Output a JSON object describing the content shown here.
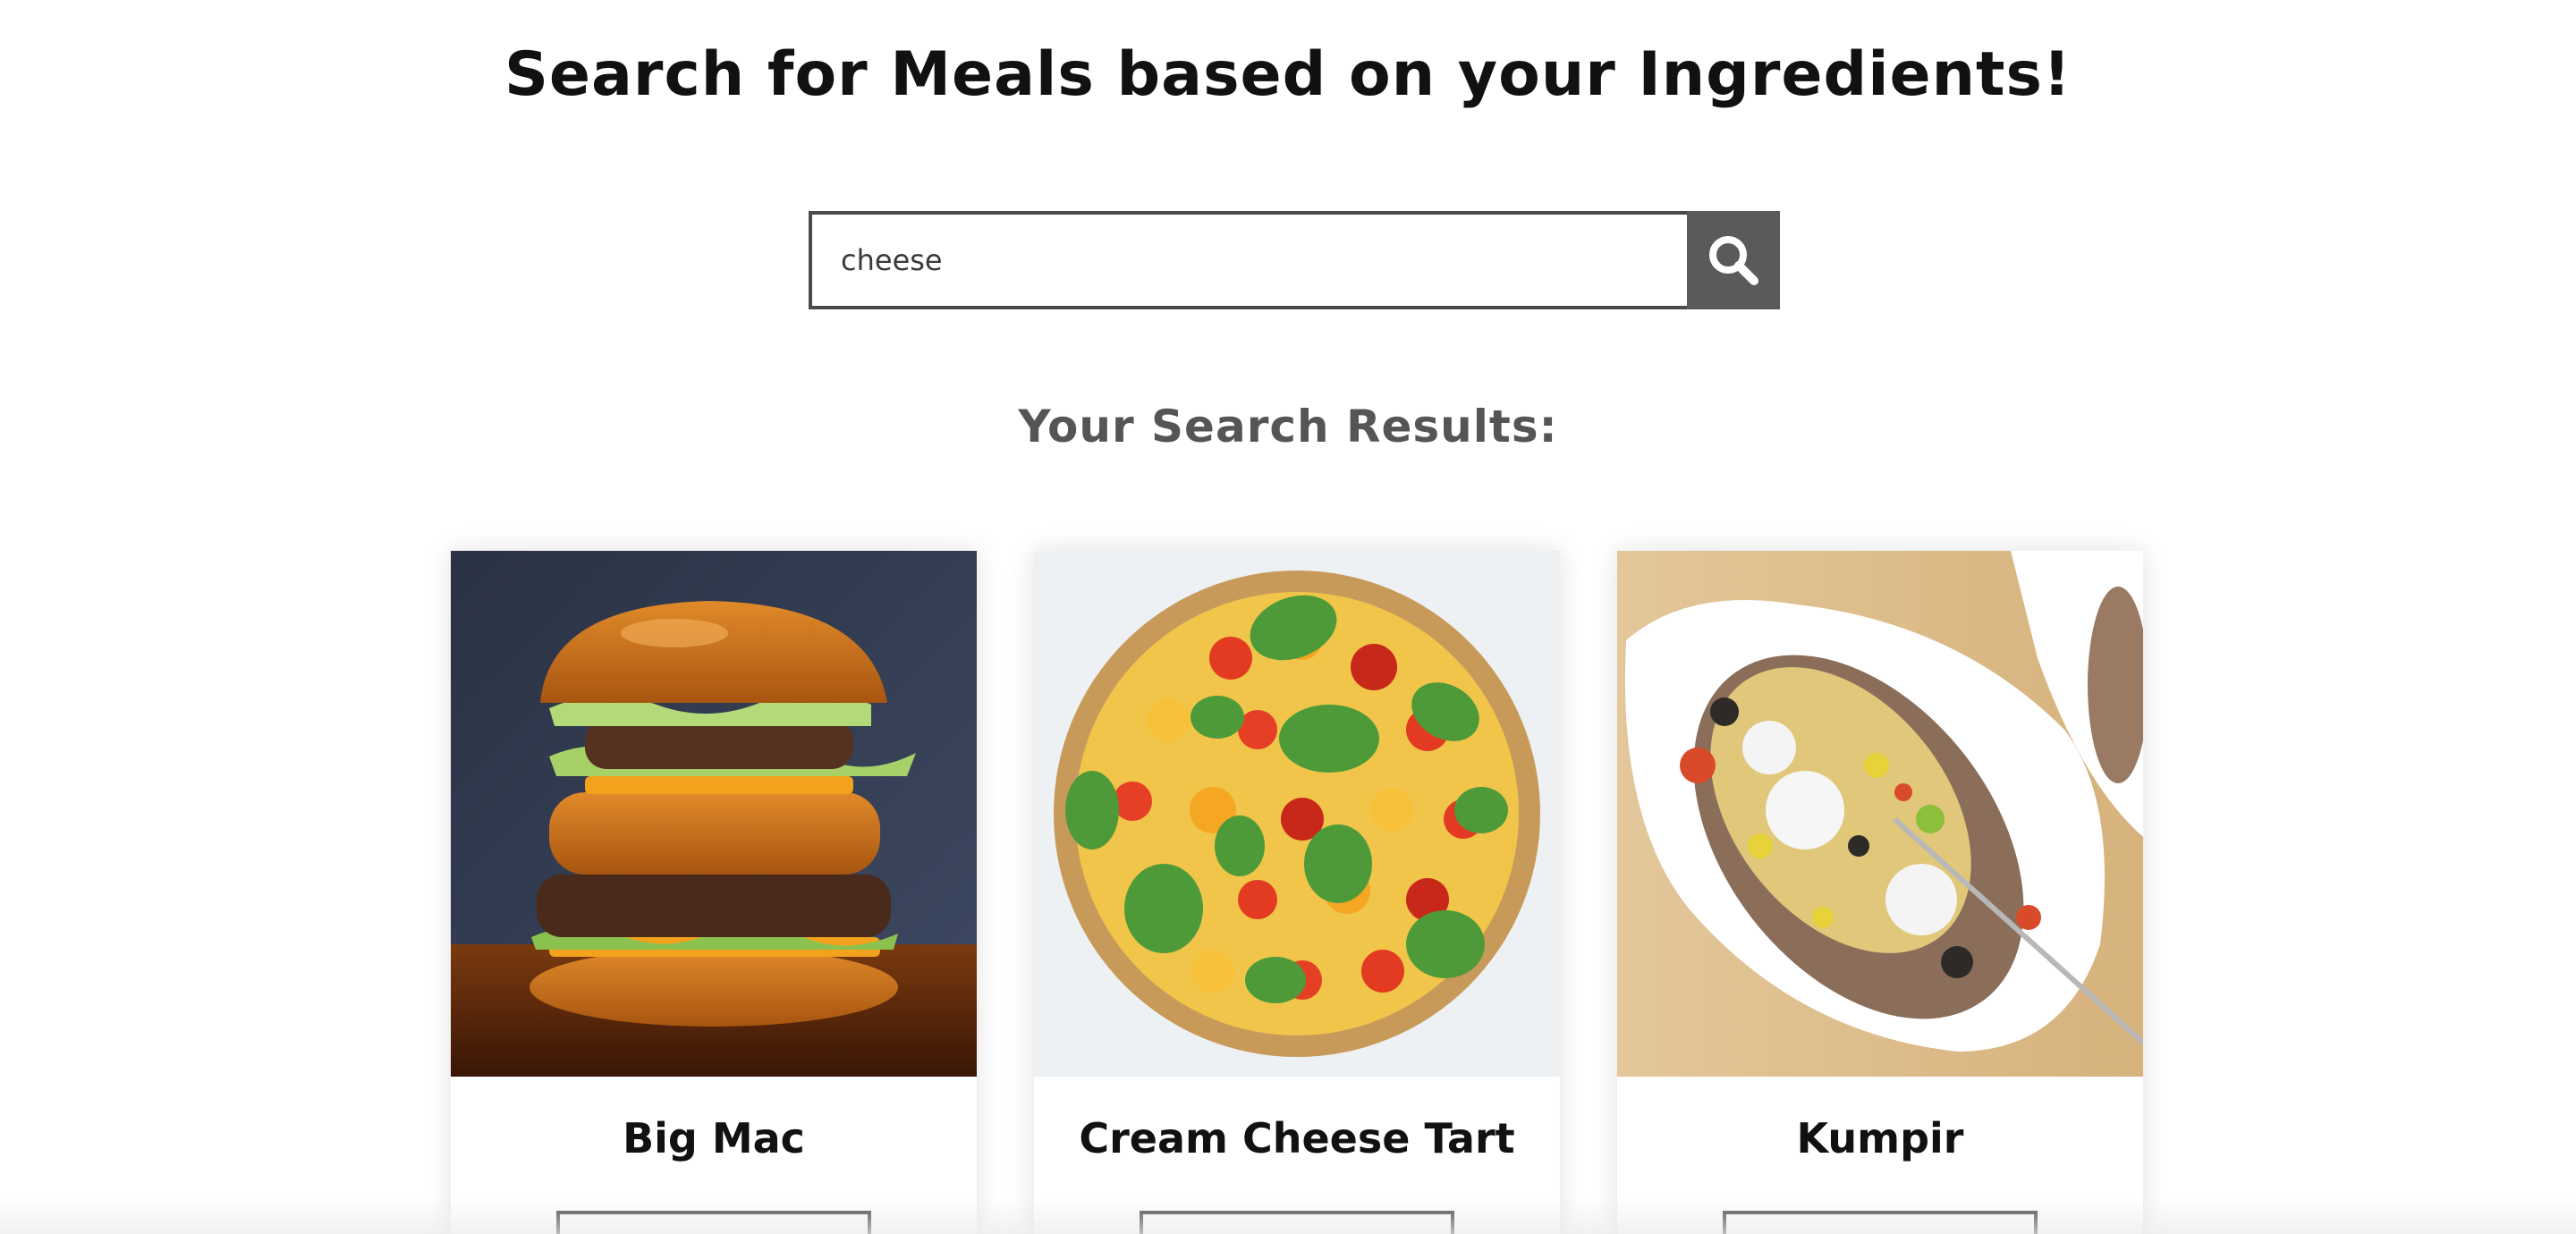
{
  "header": {
    "title": "Search for Meals based on your Ingredients!"
  },
  "search": {
    "value": "cheese",
    "button_icon": "search-icon",
    "button_color": "#5a5a5a"
  },
  "results": {
    "heading": "Your Search Results:",
    "meals": [
      {
        "name": "Big Mac",
        "image": "burger-photo"
      },
      {
        "name": "Cream Cheese Tart",
        "image": "tomato-tart-photo"
      },
      {
        "name": "Kumpir",
        "image": "stuffed-baked-potato-photo"
      }
    ]
  }
}
